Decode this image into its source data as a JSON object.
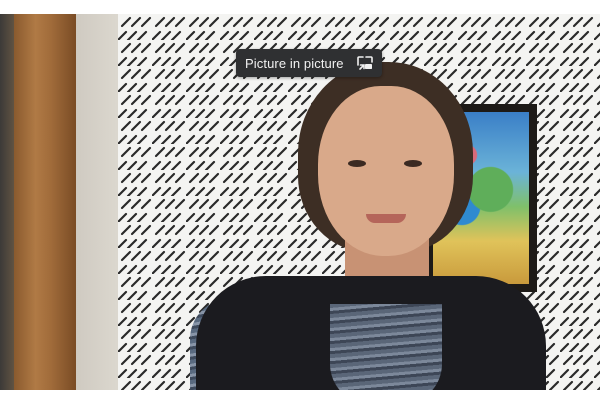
{
  "pip_button": {
    "label": "Picture in picture",
    "icon": "picture-in-picture-icon"
  },
  "colors": {
    "pip_background": "#2f3032",
    "pip_text": "#f1f1f1",
    "page_background": "#ffffff"
  }
}
